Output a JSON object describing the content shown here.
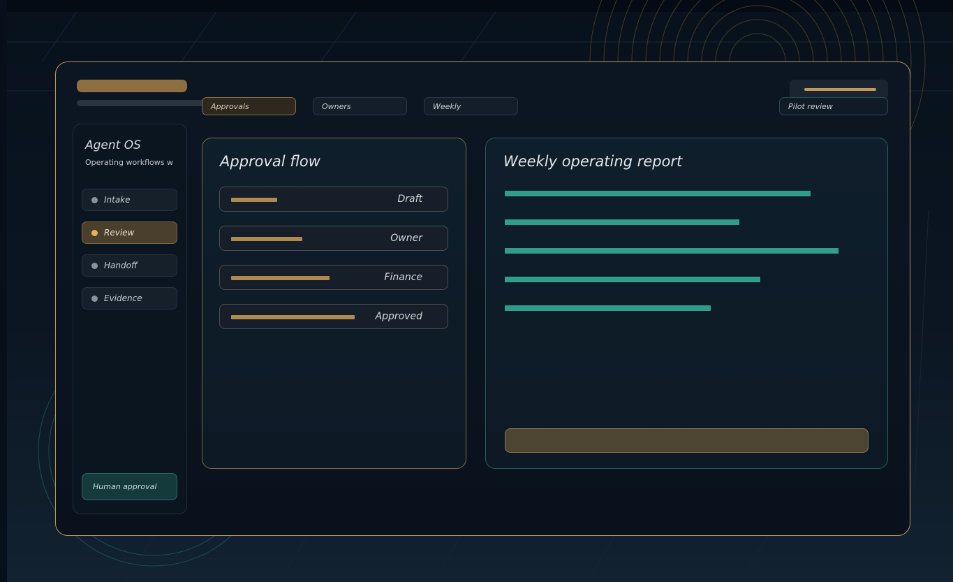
{
  "app": {
    "name": "Agent OS",
    "subtitle": "Operating workflows wi"
  },
  "tabs": [
    {
      "label": "Approvals",
      "active": true
    },
    {
      "label": "Owners",
      "active": false
    },
    {
      "label": "Weekly",
      "active": false
    }
  ],
  "pilot_review": {
    "label": "Pilot review"
  },
  "sidebar": {
    "items": [
      {
        "label": "Intake",
        "active": false
      },
      {
        "label": "Review",
        "active": true
      },
      {
        "label": "Handoff",
        "active": false
      },
      {
        "label": "Evidence",
        "active": false
      }
    ],
    "human_approval_label": "Human approval"
  },
  "approval_flow": {
    "title": "Approval flow",
    "steps": [
      {
        "label": "Draft",
        "progress": 0.22
      },
      {
        "label": "Owner",
        "progress": 0.34
      },
      {
        "label": "Finance",
        "progress": 0.47
      },
      {
        "label": "Approved",
        "progress": 0.59
      }
    ]
  },
  "report": {
    "title": "Weekly operating report",
    "bars": [
      0.84,
      0.645,
      0.917,
      0.703,
      0.566
    ]
  },
  "colors": {
    "accent_gold": "#b8965a",
    "accent_teal": "#2f9c8c",
    "background": "#0a1520"
  }
}
